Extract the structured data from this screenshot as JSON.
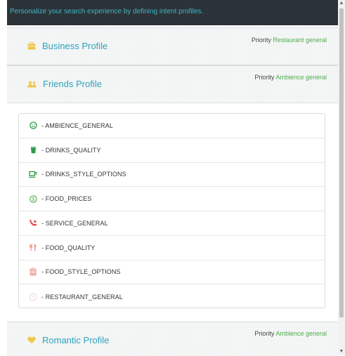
{
  "header": {
    "description": "Personalize your search experience by defining intent profiles."
  },
  "profiles": [
    {
      "name": "Business Profile",
      "priority_label": "Priority",
      "priority_value": "Restaurant general",
      "icon": "briefcase-icon"
    },
    {
      "name": "Friends Profile",
      "priority_label": "Priority",
      "priority_value": "Ambience general",
      "icon": "group-icon"
    },
    {
      "name": "Romantic Profile",
      "priority_label": "Priority",
      "priority_value": "Ambience general",
      "icon": "heart-icon"
    }
  ],
  "intents": [
    {
      "label": "- AMBIENCE_GENERAL",
      "icon": "smiley-icon",
      "color": "#2e9a4a"
    },
    {
      "label": "- DRINKS_QUALITY",
      "icon": "drink-glass-icon",
      "color": "#2e9a4a"
    },
    {
      "label": "- DRINKS_STYLE_OPTIONS",
      "icon": "coffee-cup-icon",
      "color": "#2e9a4a"
    },
    {
      "label": "- FOOD_PRICES",
      "icon": "dollar-coin-icon",
      "color": "#4dae4a"
    },
    {
      "label": "- SERVICE_GENERAL",
      "icon": "waiter-icon",
      "color": "#e8505b"
    },
    {
      "label": "- FOOD_QUALITY",
      "icon": "cutlery-icon",
      "color": "#f08a7e"
    },
    {
      "label": "- FOOD_STYLE_OPTIONS",
      "icon": "clipboard-icon",
      "color": "#f4a9a3"
    },
    {
      "label": "- RESTAURANT_GENERAL",
      "icon": "circle-icon",
      "color": "#f6d6d3"
    }
  ],
  "colors": {
    "accent_teal": "#2fa3bd",
    "priority_green": "#4dae4a",
    "topbar_bg": "#2c3338",
    "topbar_text": "#3fb6c6",
    "profile_icon_yellow": "#f0c64a"
  }
}
